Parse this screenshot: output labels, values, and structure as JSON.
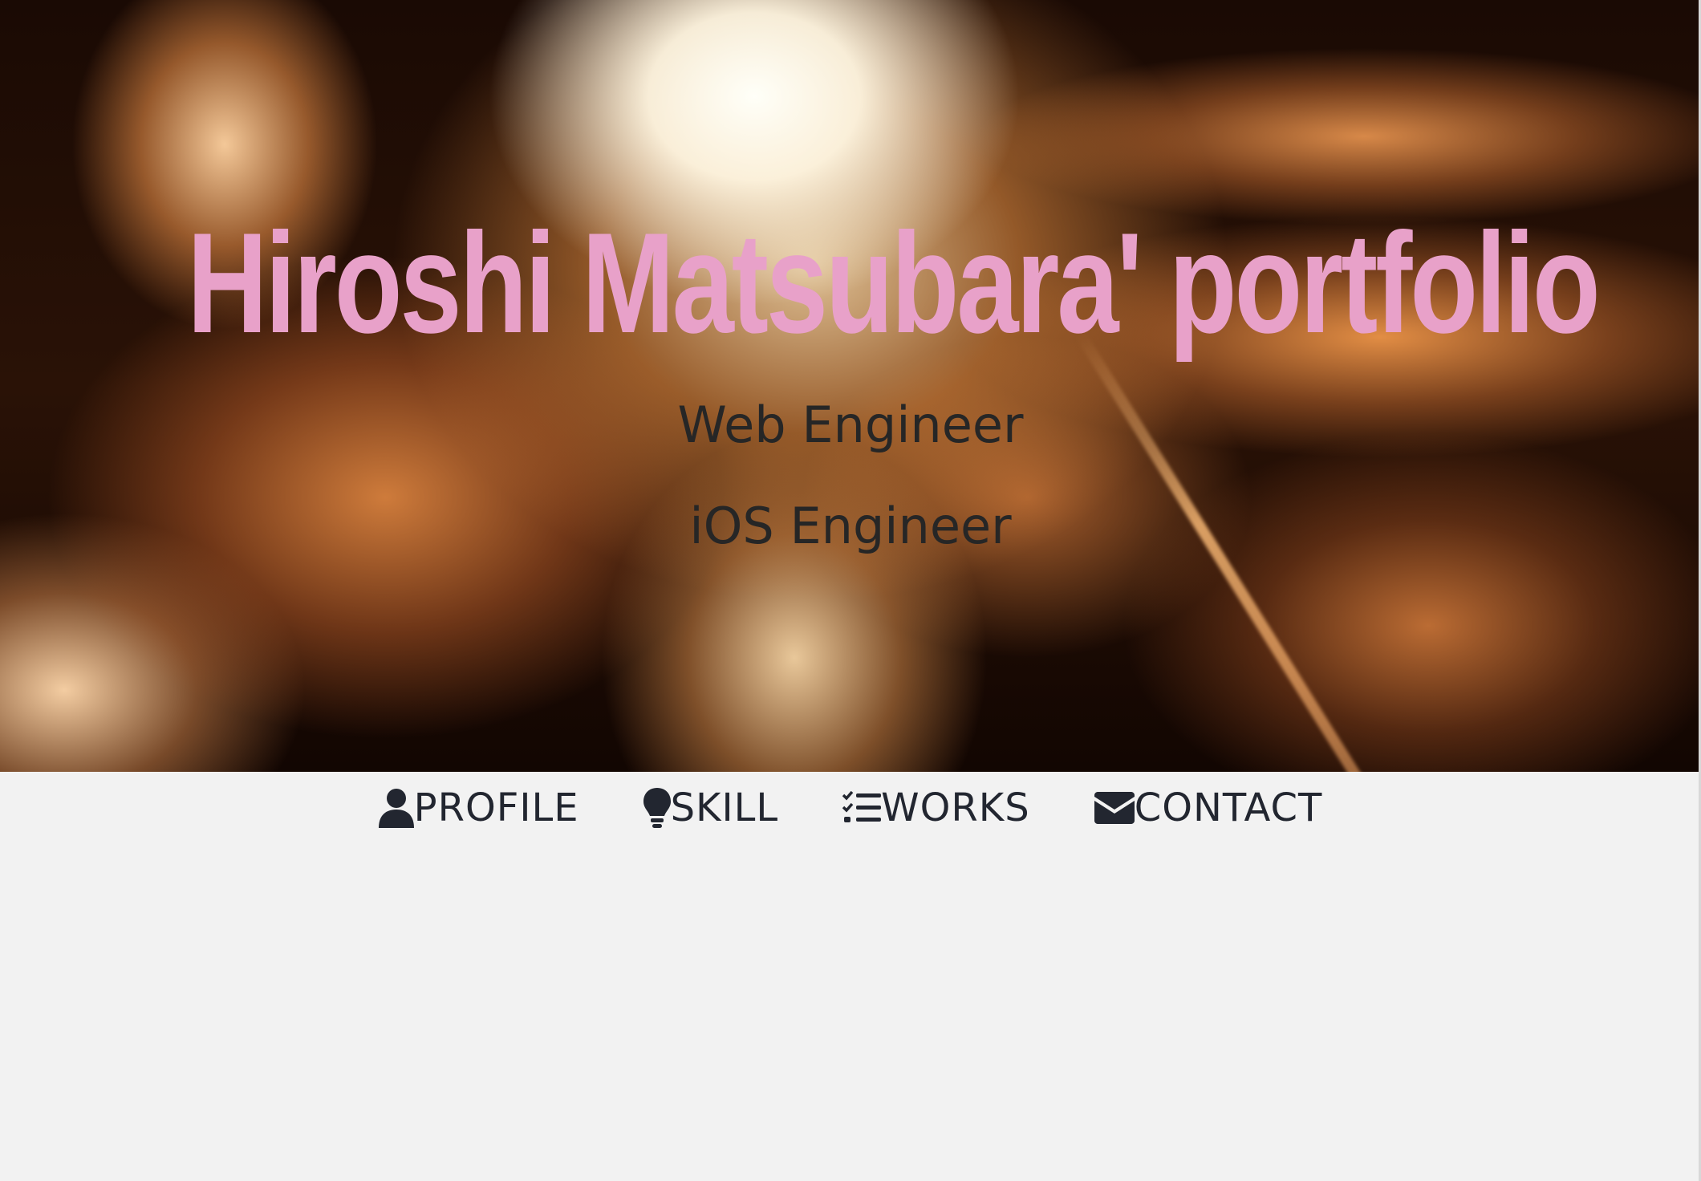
{
  "hero": {
    "title": "Hiroshi Matsubara' portfolio",
    "roles": [
      "Web Engineer",
      "iOS Engineer"
    ],
    "title_color": "#e8a1c9"
  },
  "nav": {
    "items": [
      {
        "label": "PROFILE",
        "icon": "user-icon"
      },
      {
        "label": "SKILL",
        "icon": "lightbulb-icon"
      },
      {
        "label": "WORKS",
        "icon": "checklist-icon"
      },
      {
        "label": "CONTACT",
        "icon": "envelope-icon"
      }
    ],
    "text_color": "#222630"
  },
  "colors": {
    "background": "#f2f2f2"
  }
}
